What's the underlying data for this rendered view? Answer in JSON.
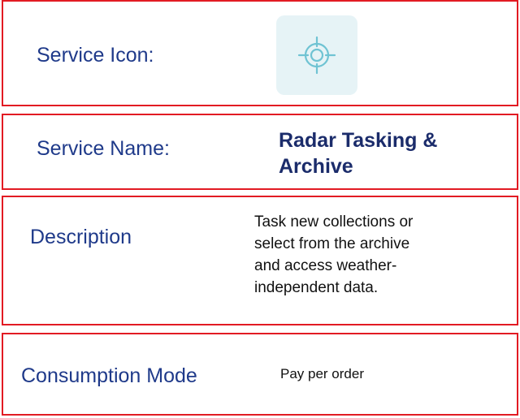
{
  "colors": {
    "border": "#e21b23",
    "label": "#1f3a8a",
    "name": "#1b2c6b",
    "icon_tile": "#e6f3f6",
    "icon_stroke": "#6fc3d3"
  },
  "service_icon": {
    "label": "Service Icon:",
    "icon": "crosshair-target-icon"
  },
  "service_name": {
    "label": "Service Name:",
    "value": "Radar Tasking & Archive"
  },
  "description": {
    "label": "Description",
    "value": "Task new collections or select from the archive and access weather-independent data."
  },
  "consumption_mode": {
    "label": "Consumption Mode",
    "value": "Pay per order"
  }
}
